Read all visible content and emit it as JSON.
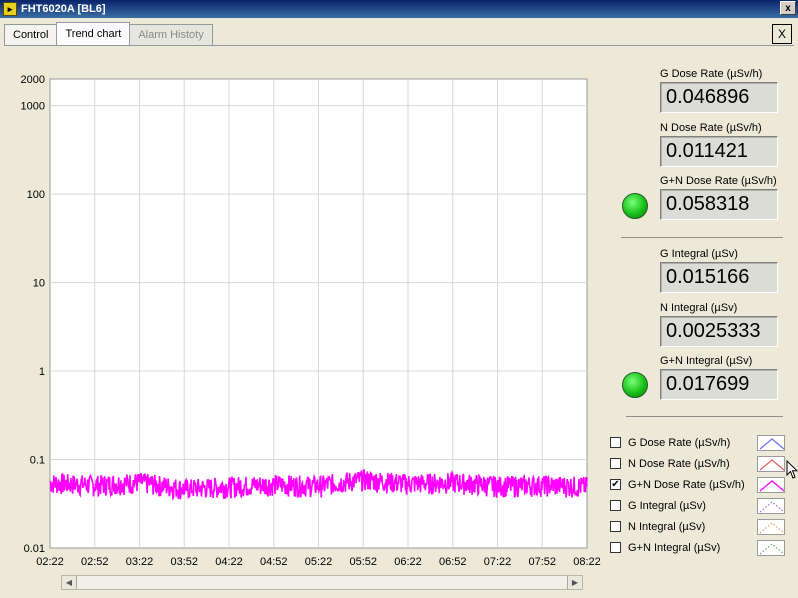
{
  "window": {
    "title": "FHT6020A [BL6]",
    "close_glyph": "x"
  },
  "tabs": [
    {
      "label": "Control"
    },
    {
      "label": "Trend chart"
    },
    {
      "label": "Alarm Histoty"
    }
  ],
  "panel_close": "X",
  "indicators": [
    {
      "label": "G Dose Rate (µSv/h)",
      "value": "0.046896"
    },
    {
      "label": "N Dose Rate (µSv/h)",
      "value": "0.011421"
    },
    {
      "label": "G+N Dose Rate (µSv/h)",
      "value": "0.058318"
    },
    {
      "label": "G Integral (µSv)",
      "value": "0.015166"
    },
    {
      "label": "N Integral (µSv)",
      "value": "0.0025333"
    },
    {
      "label": "G+N Integral (µSv)",
      "value": "0.017699"
    }
  ],
  "led_color": "#18c018",
  "legend": [
    {
      "label": "G Dose Rate (µSv/h)",
      "checked": false,
      "color": "#6a7ae8",
      "style": "solid"
    },
    {
      "label": "N Dose Rate (µSv/h)",
      "checked": false,
      "color": "#e06060",
      "style": "solid"
    },
    {
      "label": "G+N Dose Rate (µSv/h)",
      "checked": true,
      "color": "#ff00ff",
      "style": "solid"
    },
    {
      "label": "G Integral (µSv)",
      "checked": false,
      "color": "#a070e0",
      "style": "dotted"
    },
    {
      "label": "N Integral (µSv)",
      "checked": false,
      "color": "#e8a070",
      "style": "dotted"
    },
    {
      "label": "G+N Integral (µSv)",
      "checked": false,
      "color": "#70b070",
      "style": "dotted"
    }
  ],
  "chart_data": {
    "type": "line",
    "yscale": "log",
    "ylim": [
      0.01,
      2000
    ],
    "yticks": [
      "2000",
      "1000",
      "100",
      "10",
      "1",
      "0.1",
      "0.01"
    ],
    "ytick_values": [
      2000,
      1000,
      100,
      10,
      1,
      0.1,
      0.01
    ],
    "xticks": [
      "02:22",
      "02:52",
      "03:22",
      "03:52",
      "04:22",
      "04:52",
      "05:22",
      "05:52",
      "06:22",
      "06:52",
      "07:22",
      "07:52",
      "08:22"
    ],
    "grid": true,
    "series": [
      {
        "color": "#ff00ff",
        "x": [
          "02:22",
          "02:52",
          "03:22",
          "03:52",
          "04:22",
          "04:52",
          "05:22",
          "05:52",
          "06:22",
          "06:52",
          "07:22",
          "07:52",
          "08:22"
        ],
        "values": [
          0.055,
          0.052,
          0.056,
          0.047,
          0.05,
          0.053,
          0.051,
          0.06,
          0.054,
          0.056,
          0.051,
          0.052,
          0.05
        ]
      }
    ]
  }
}
